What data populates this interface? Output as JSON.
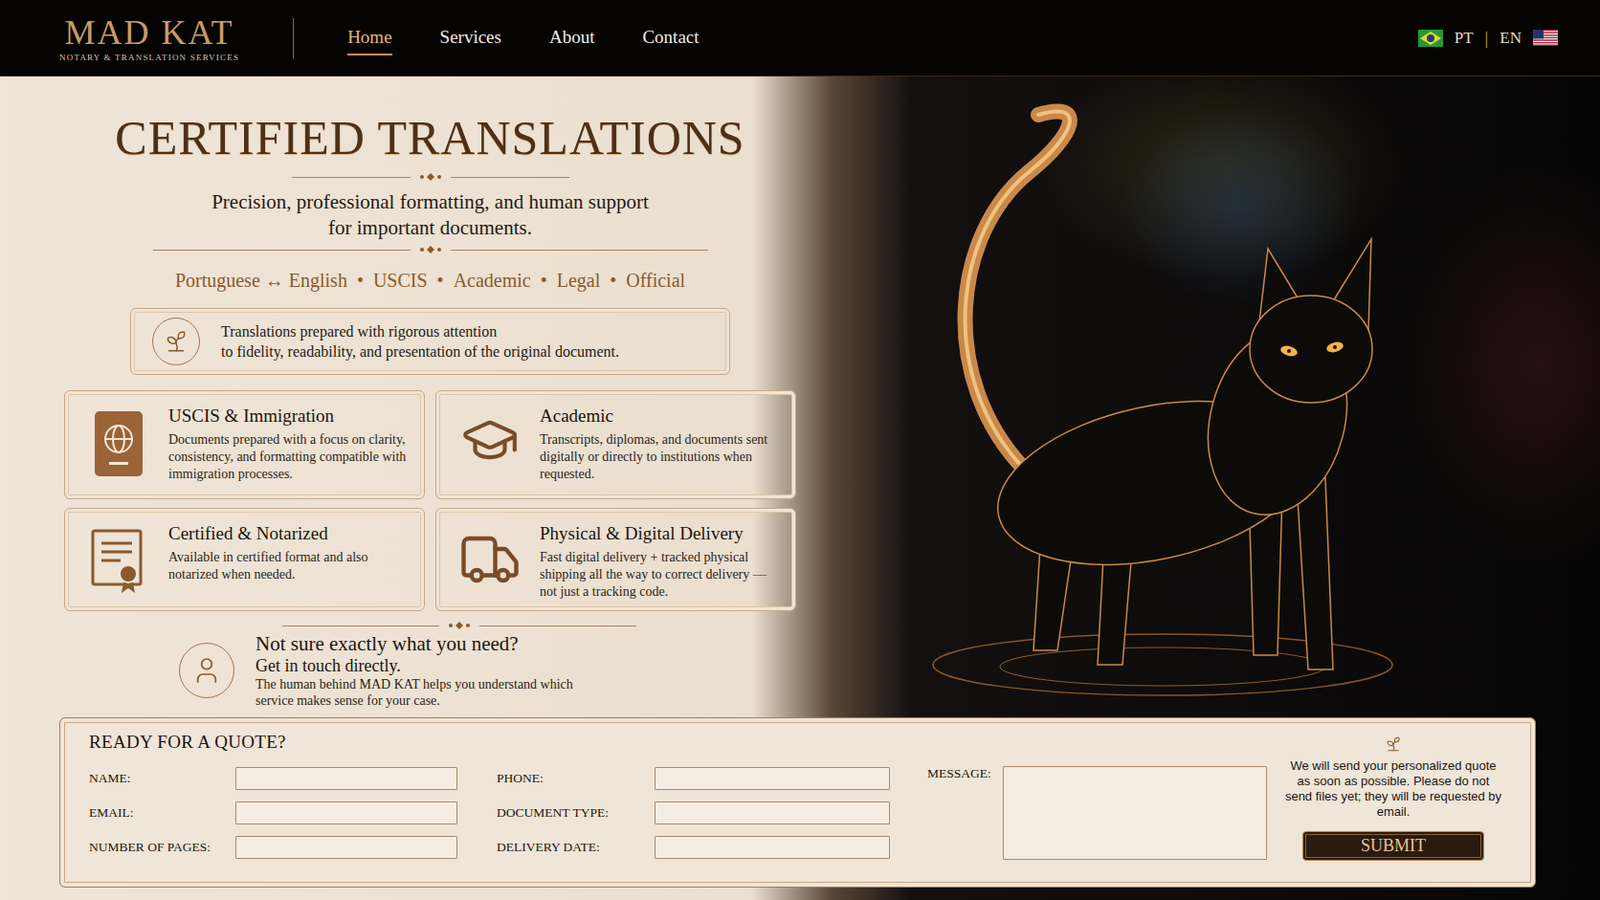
{
  "nav": {
    "logo": "MAD KAT",
    "tagline": "NOTARY & TRANSLATION SERVICES",
    "links": [
      {
        "label": "Home",
        "selected": true
      },
      {
        "label": "Services",
        "selected": false
      },
      {
        "label": "About",
        "selected": false
      },
      {
        "label": "Contact",
        "selected": false
      }
    ],
    "languages": [
      {
        "code": "PT",
        "kind": "brazil"
      },
      {
        "code": "EN",
        "kind": "usa"
      }
    ],
    "language_separator": "|"
  },
  "hero": {
    "title": "CERTIFIED TRANSLATIONS",
    "subtitle_lines": [
      "Precision, professional formatting, and human support",
      "for important documents."
    ],
    "tags": [
      "Portuguese ↔ English",
      "USCIS",
      "Academic",
      "Legal",
      "Official"
    ],
    "tag_separator": "•",
    "intro_lines": [
      "Translations prepared with rigorous attention",
      "to fidelity, readability, and presentation of the original document."
    ]
  },
  "cards": [
    {
      "title": "USCIS & Immigration",
      "description": "Documents prepared with a focus on clarity, consistency, and formatting compatible with immigration processes."
    },
    {
      "title": "Academic",
      "description": "Transcripts, diplomas, and documents sent digitally or directly to institutions when requested."
    },
    {
      "title": "Certified & Notarized",
      "description": "Available in certified format and also notarized when needed."
    },
    {
      "title": "Physical & Digital Delivery",
      "description": "Fast digital delivery + tracked physical shipping all the way to correct delivery — not just a tracking code."
    }
  ],
  "contact": {
    "title": "Not sure exactly what you need?",
    "subtitle": "Get in touch directly.",
    "description": "The human behind MAD KAT helps you understand which service makes sense for your case."
  },
  "form": {
    "title": "READY FOR A QUOTE?",
    "fields": [
      {
        "label": "NAME:"
      },
      {
        "label": "EMAIL:"
      },
      {
        "label": "NUMBER OF PAGES:"
      },
      {
        "label": "PHONE:"
      },
      {
        "label": "DOCUMENT TYPE:"
      },
      {
        "label": "DELIVERY DATE:"
      }
    ],
    "message_label": "MESSAGE:",
    "note": "We will send your personalized quote as soon as possible. Please do not send files yet; they will be requested by email.",
    "submit": "SUBMIT"
  }
}
